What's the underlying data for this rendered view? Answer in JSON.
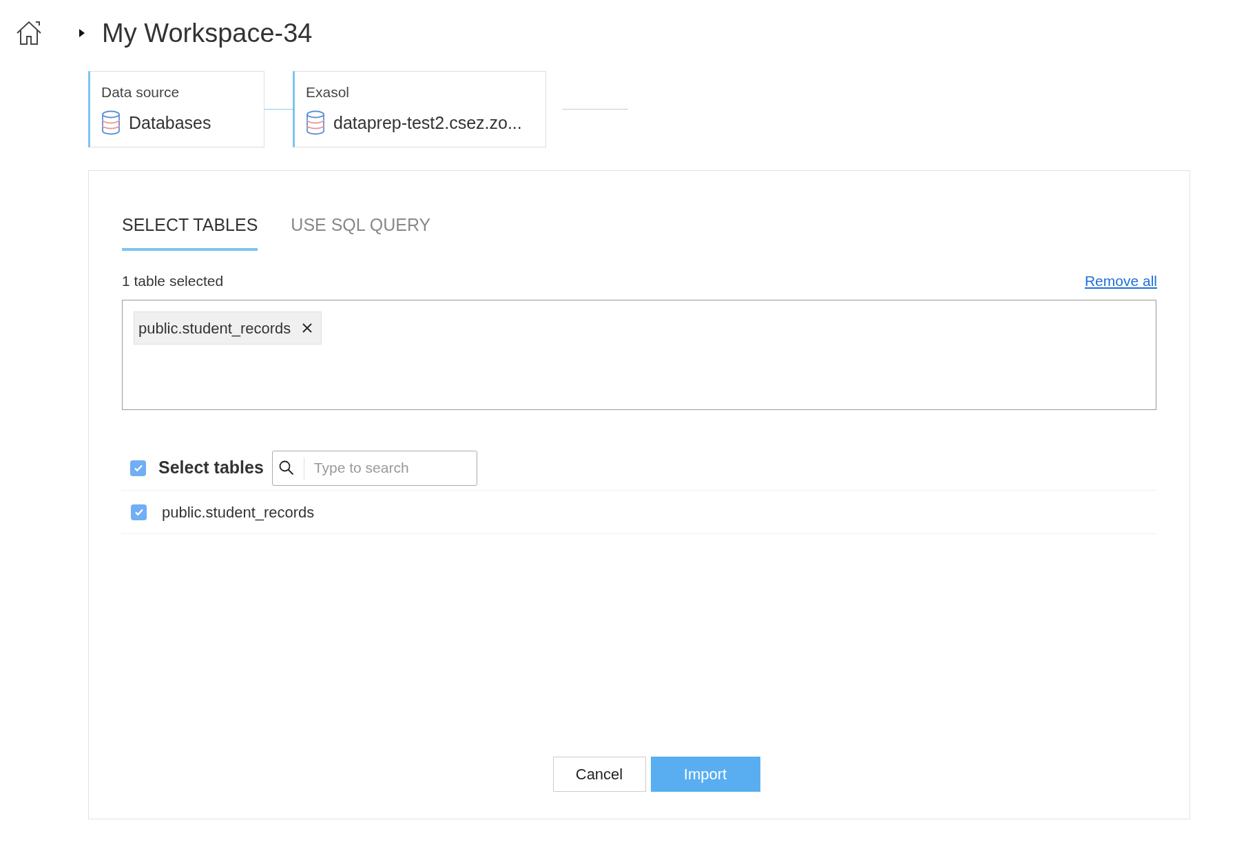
{
  "breadcrumb": {
    "title": "My Workspace-34"
  },
  "steps": [
    {
      "label": "Data source",
      "value": "Databases"
    },
    {
      "label": "Exasol",
      "value": "dataprep-test2.csez.zo..."
    }
  ],
  "tabs": [
    {
      "label": "SELECT TABLES",
      "selected": true
    },
    {
      "label": "USE SQL QUERY",
      "selected": false
    }
  ],
  "selection": {
    "summary": "1 table selected",
    "remove_all": "Remove all",
    "chips": [
      "public.student_records"
    ]
  },
  "table_list": {
    "header": {
      "label": "Select tables",
      "checked": true
    },
    "search": {
      "placeholder": "Type to search"
    },
    "rows": [
      {
        "label": "public.student_records",
        "checked": true
      }
    ]
  },
  "buttons": {
    "cancel": "Cancel",
    "import": "Import"
  }
}
